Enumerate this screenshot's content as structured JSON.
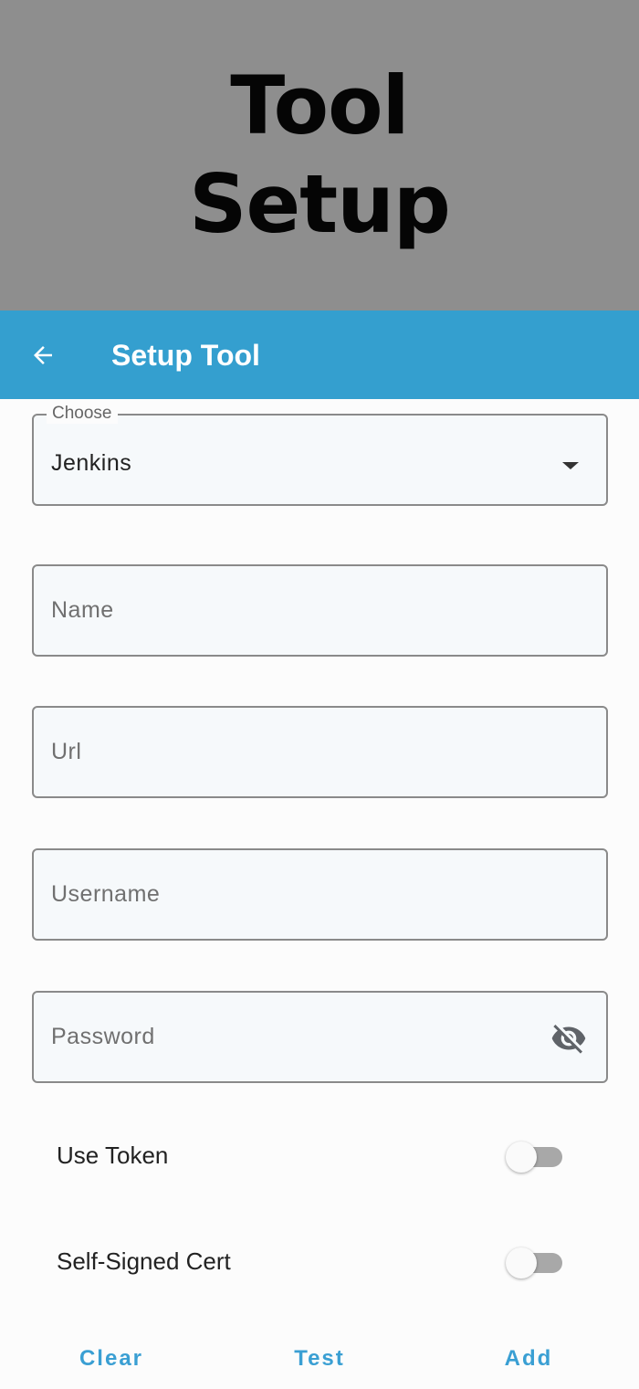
{
  "banner": {
    "title": "Tool Setup"
  },
  "appbar": {
    "title": "Setup Tool",
    "back_icon": "arrow-left-icon"
  },
  "form": {
    "choose": {
      "legend": "Choose",
      "value": "Jenkins"
    },
    "name": {
      "placeholder": "Name"
    },
    "url": {
      "placeholder": "Url"
    },
    "username": {
      "placeholder": "Username"
    },
    "password": {
      "placeholder": "Password",
      "icon": "eye-off-icon"
    },
    "use_token": {
      "label": "Use Token",
      "on": false
    },
    "self_signed": {
      "label": "Self-Signed Cert",
      "on": false
    }
  },
  "actions": {
    "clear": "Clear",
    "test": "Test",
    "add": "Add"
  },
  "colors": {
    "appbar": "#349fcf",
    "accent": "#3a9fd3",
    "banner": "#8e8e8e"
  }
}
